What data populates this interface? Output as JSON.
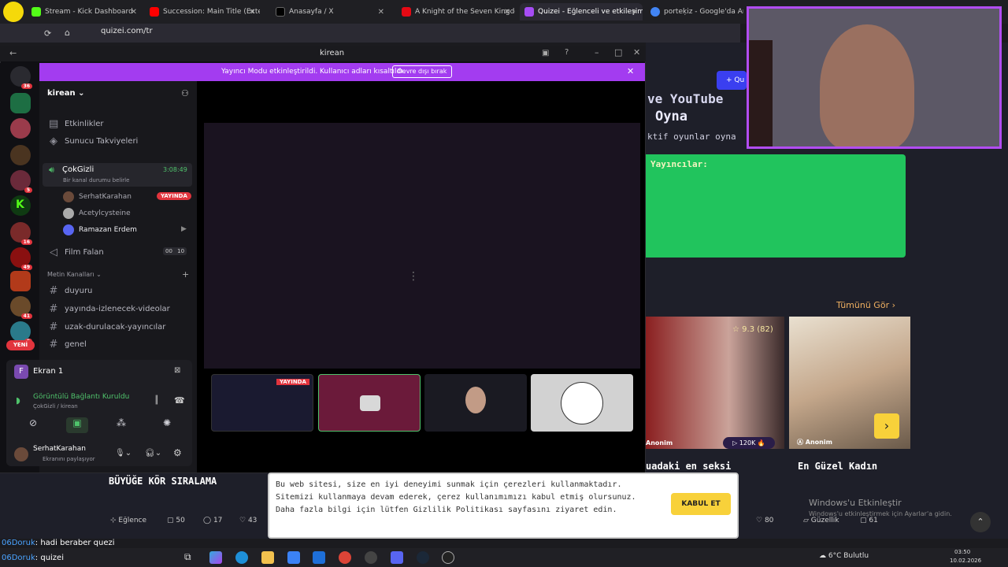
{
  "browser": {
    "tabs": [
      {
        "label": "Stream - Kick Dashboard",
        "fav": "#53fc18"
      },
      {
        "label": "Succession: Main Title (Exte",
        "fav": "#ff0000"
      },
      {
        "label": "Anasayfa / X",
        "fav": "#000000"
      },
      {
        "label": "A Knight of the Seven Kingdom",
        "fav": "#e50914"
      },
      {
        "label": "Quizei - Eğlenceli ve etkileşimli",
        "fav": "#a64cf5"
      },
      {
        "label": "porteķiz - Google'da Ara",
        "fav": "#4285f4"
      }
    ],
    "url": "quizei.com/tr"
  },
  "discord": {
    "window_title": "kirean",
    "banner_text": "Yayıncı Modu etkinleştirildi. Kullanıcı adları kısaltıldı.",
    "banner_button": "Devre dışı bırak",
    "server_name": "kirean",
    "top_items": [
      "Etkinlikler",
      "Sunucu Takviyeleri"
    ],
    "voice_channel": {
      "name": "ÇokGizli",
      "status": "Bir kanal durumu belirle",
      "time": "3:08:49"
    },
    "voice_users": [
      {
        "name": "SerhatKarahan",
        "live": "YAYINDA"
      },
      {
        "name": "Acetylcysteine",
        "live": ""
      },
      {
        "name": "Ramazan Erdem",
        "live": ""
      }
    ],
    "voice_channel2": {
      "name": "Film Falan",
      "count_left": "00",
      "count_right": "10"
    },
    "category": "Metin Kanalları",
    "text_channels": [
      "duyuru",
      "yayında-izlenecek-videolar",
      "uzak-durulacak-yayıncılar",
      "genel"
    ],
    "screen_panel": {
      "title": "Ekran 1",
      "icon_letter": "F"
    },
    "connection": {
      "status": "Görüntülü Bağlantı Kuruldu",
      "sub": "ÇokGizli / kirean"
    },
    "user": {
      "name": "SerhatKarahan",
      "status": "Ekranını paylaşıyor"
    },
    "tile_live": "YAYINDA",
    "server_badges": [
      "36",
      "5",
      "16",
      "49",
      "41",
      "6"
    ],
    "new_badge": "YENİ"
  },
  "webpage": {
    "hero_line1": "ve YouTube",
    "hero_line2": "Oyna",
    "hero_line3": "ktif oyunlar oyna",
    "hero_line4": "Yayıncılar:",
    "see_all": "Tümünü Gör",
    "card1": {
      "rating": "9.3",
      "votes": "(82)",
      "plays": "120K",
      "author": "Anonim",
      "title": "uadaki en seksi"
    },
    "card2": {
      "author": "Anonim",
      "title": "En Güzel Kadın",
      "category": "Güzellik",
      "a": "61",
      "b": "80"
    },
    "left_card": {
      "title": "BÜYÜĞE KÖR SIRALAMA",
      "category": "Eğlence",
      "stat1": "50",
      "stat2": "17",
      "stat3": "43"
    },
    "win_activate": "Windows'u Etkinleştir",
    "win_activate_sub": "Windows'u etkinleştirmek için Ayarlar'a gidin.",
    "top_button": "+ Qu"
  },
  "cookie": {
    "text": "Bu web sitesi, size en iyi deneyimi sunmak için çerezleri kullanmaktadır. Sitemizi kullanmaya devam ederek, çerez kullanımımızı kabul etmiş olursunuz. Daha fazla bilgi için lütfen Gizlilik Politikası sayfasını ziyaret edin.",
    "accept": "KABUL ET"
  },
  "chat": [
    {
      "user": "06Doruk",
      "msg": ": hadi beraber quezi"
    },
    {
      "user": "06Doruk",
      "msg": ": quizei"
    }
  ],
  "taskbar": {
    "weather": "6°C Bulutlu",
    "time": "03:50",
    "date": "10.02.2026"
  }
}
